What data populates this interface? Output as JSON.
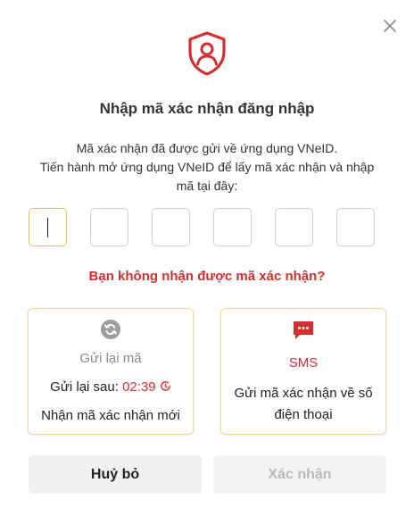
{
  "dialog": {
    "title": "Nhập mã xác nhận đăng nhập",
    "description_line1": "Mã xác nhận đã được gửi về ứng dụng VNeID.",
    "description_line2": "Tiến hành mở ứng dụng VNeID để lấy mã xác nhận và nhập",
    "description_line3": "mã tại đây:",
    "otp_digits": [
      "",
      "",
      "",
      "",
      "",
      ""
    ],
    "no_code_prompt": "Bạn không nhận được mã xác nhận?"
  },
  "resend_option": {
    "label": "Gửi lại mã",
    "countdown_label": "Gửi lại sau:",
    "countdown_time": "02:39",
    "description": "Nhận mã xác nhận mới",
    "icon": "refresh-icon"
  },
  "sms_option": {
    "label": "SMS",
    "description": "Gửi mã xác nhận về số điện thoại",
    "icon": "sms-icon"
  },
  "buttons": {
    "cancel": "Huỷ bỏ",
    "confirm": "Xác nhận"
  },
  "colors": {
    "accent_red": "#d32f2f",
    "card_border": "#efd98a",
    "button_bg": "#f0f0f0"
  }
}
